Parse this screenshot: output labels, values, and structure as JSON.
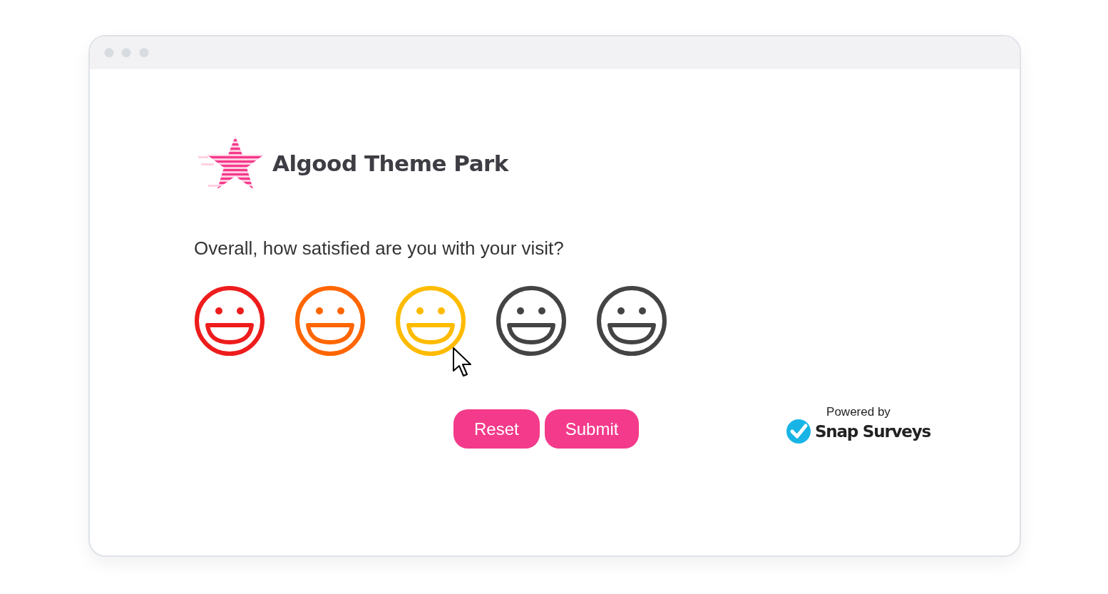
{
  "brand": {
    "name": "Algood Theme Park"
  },
  "question": "Overall, how satisfied are you with your visit?",
  "faces": [
    {
      "color": "#ee1c1c"
    },
    {
      "color": "#ff6600"
    },
    {
      "color": "#ffbb00"
    },
    {
      "color": "#444444"
    },
    {
      "color": "#444444"
    }
  ],
  "buttons": [
    "Reset",
    "Submit"
  ],
  "powered_by": {
    "label": "Powered by",
    "brand": "Snap Surveys"
  }
}
